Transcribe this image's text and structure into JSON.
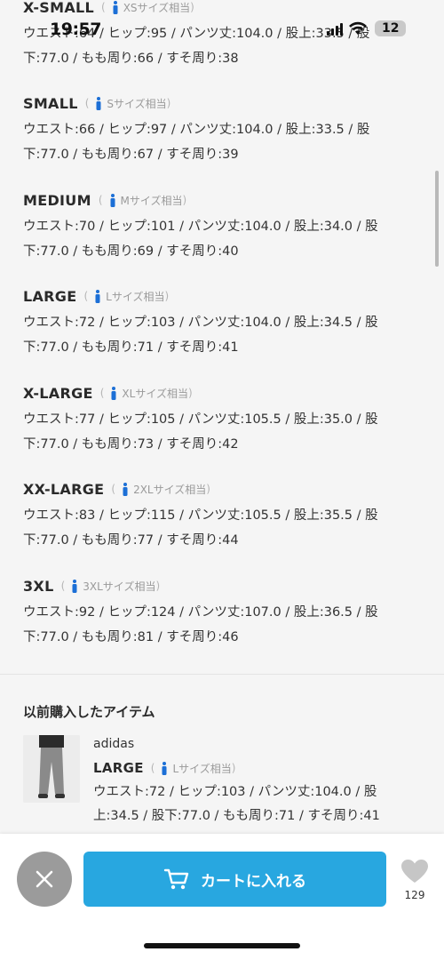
{
  "status": {
    "time": "19:57",
    "battery": "12"
  },
  "sizes": [
    {
      "name": "X-SMALL",
      "equiv": "XSサイズ相当",
      "line1": "ウエスト:64 / ヒップ:95 / パンツ丈:104.0 / 股上:33.5 / 股",
      "line2": "下:77.0 / もも周り:66 / すそ周り:38"
    },
    {
      "name": "SMALL",
      "equiv": "Sサイズ相当",
      "line1": "ウエスト:66 / ヒップ:97 / パンツ丈:104.0 / 股上:33.5 / 股",
      "line2": "下:77.0 / もも周り:67 / すそ周り:39"
    },
    {
      "name": "MEDIUM",
      "equiv": "Mサイズ相当",
      "line1": "ウエスト:70 / ヒップ:101 / パンツ丈:104.0 / 股上:34.0 / 股",
      "line2": "下:77.0 / もも周り:69 / すそ周り:40"
    },
    {
      "name": "LARGE",
      "equiv": "Lサイズ相当",
      "line1": "ウエスト:72 / ヒップ:103 / パンツ丈:104.0 / 股上:34.5 / 股",
      "line2": "下:77.0 / もも周り:71 / すそ周り:41"
    },
    {
      "name": "X-LARGE",
      "equiv": "XLサイズ相当",
      "line1": "ウエスト:77 / ヒップ:105 / パンツ丈:105.5 / 股上:35.0 / 股",
      "line2": "下:77.0 / もも周り:73 / すそ周り:42"
    },
    {
      "name": "XX-LARGE",
      "equiv": "2XLサイズ相当",
      "line1": "ウエスト:83 / ヒップ:115 / パンツ丈:105.5 / 股上:35.5 / 股",
      "line2": "下:77.0 / もも周り:77 / すそ周り:44"
    },
    {
      "name": "3XL",
      "equiv": "3XLサイズ相当",
      "line1": "ウエスト:92 / ヒップ:124 / パンツ丈:107.0 / 股上:36.5 / 股",
      "line2": "下:77.0 / もも周り:81 / すそ周り:46"
    }
  ],
  "previous": {
    "title": "以前購入したアイテム",
    "brand": "adidas",
    "size_name": "LARGE",
    "size_equiv": "Lサイズ相当",
    "line1": "ウエスト:72 / ヒップ:103 / パンツ丈:104.0 / 股",
    "line2": "上:34.5 / 股下:77.0 / もも周り:71 / すそ周り:41"
  },
  "actions": {
    "cart_label": "カートに入れる",
    "fav_count": "129"
  },
  "colors": {
    "accent": "#28a7e0",
    "person_icon": "#1c6fd6"
  }
}
